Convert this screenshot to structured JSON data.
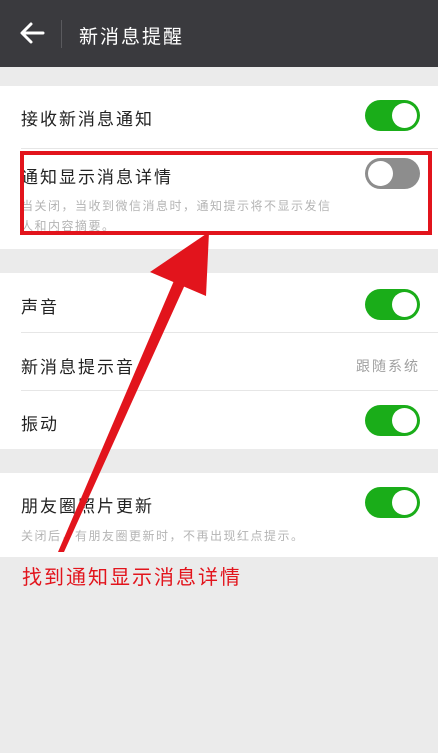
{
  "header": {
    "title": "新消息提醒"
  },
  "settings": {
    "receive": {
      "label": "接收新消息通知",
      "enabled": true
    },
    "details": {
      "label": "通知显示消息详情",
      "enabled": false,
      "hint_line1": "当关闭，当收到微信消息时，通知提示将不显示发信",
      "hint_line2": "人和内容摘要。"
    },
    "sound": {
      "label": "声音",
      "enabled": true
    },
    "ringtone": {
      "label": "新消息提示音",
      "value": "跟随系统"
    },
    "vibrate": {
      "label": "振动",
      "enabled": true
    },
    "moments": {
      "label": "朋友圈照片更新",
      "enabled": true,
      "hint": "关闭后，有朋友圈更新时，不再出现红点提示。"
    }
  },
  "annotation": {
    "text": "找到通知显示消息详情",
    "color": "#e2141c"
  },
  "colors": {
    "toggle_on": "#1aad19",
    "toggle_off": "#8d8d8d",
    "header_bg": "#3a3a3e"
  },
  "icons": {
    "back": "arrow-left-icon"
  }
}
